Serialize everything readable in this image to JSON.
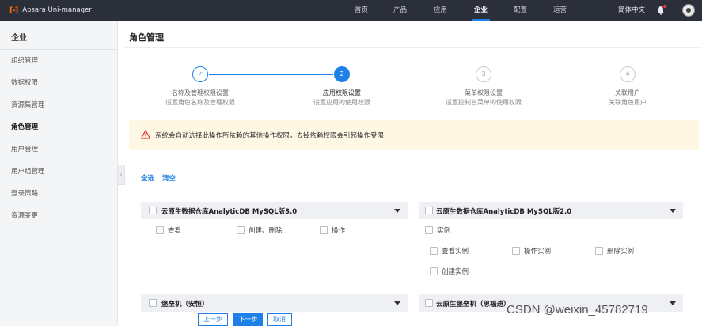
{
  "topbar": {
    "logo_mark": "[-]",
    "logo_text": "Apsara Uni-manager",
    "nav": [
      "首页",
      "产品",
      "应用",
      "企业",
      "配置",
      "运营"
    ],
    "active_nav": "企业",
    "language": "简体中文"
  },
  "sidebar": {
    "title": "企业",
    "items": [
      "组织管理",
      "数据权限",
      "资源集管理",
      "角色管理",
      "用户管理",
      "用户组管理",
      "登录策略",
      "资源变更"
    ],
    "active": "角色管理",
    "collapse_glyph": "‹"
  },
  "page": {
    "title": "角色管理"
  },
  "steps": [
    {
      "num": "✓",
      "state": "done",
      "title": "名称及管理权限设置",
      "desc": "设置角色名称及管理权限"
    },
    {
      "num": "2",
      "state": "current",
      "title": "应用权限设置",
      "desc": "设置应用的使用权限"
    },
    {
      "num": "3",
      "state": "pending",
      "title": "菜单权限设置",
      "desc": "设置控制台菜单的使用权限"
    },
    {
      "num": "4",
      "state": "pending",
      "title": "关联用户",
      "desc": "关联角色用户"
    }
  ],
  "warning": {
    "text": "系统会自动选择此操作所依赖的其他操作权限，去掉依赖权限会引起操作受限",
    "icon": "warning-icon"
  },
  "actions": {
    "select_all": "全选",
    "clear": "清空"
  },
  "panels": {
    "left_top": {
      "title": "云原生数据仓库AnalyticDB MySQL版3.0",
      "options": [
        "查看",
        "创建、删除",
        "操作"
      ]
    },
    "right_top": {
      "title": "云原生数据仓库AnalyticDB MySQL版2.0",
      "group": "实例",
      "options": [
        "查看实例",
        "操作实例",
        "删除实例",
        "创建实例"
      ]
    },
    "left_bottom": {
      "title": "堡垒机（安恒）"
    },
    "right_bottom": {
      "title": "云原生堡垒机（思福迪）"
    }
  },
  "buttons": {
    "prev": "上一步",
    "next": "下一步",
    "cancel": "取消"
  },
  "watermark": "CSDN @weixin_45782719",
  "colors": {
    "accent": "#1e80e6",
    "topbar": "#2b2f3a",
    "warning_bg": "#fdf7e3",
    "warning_icon": "#e53935"
  }
}
